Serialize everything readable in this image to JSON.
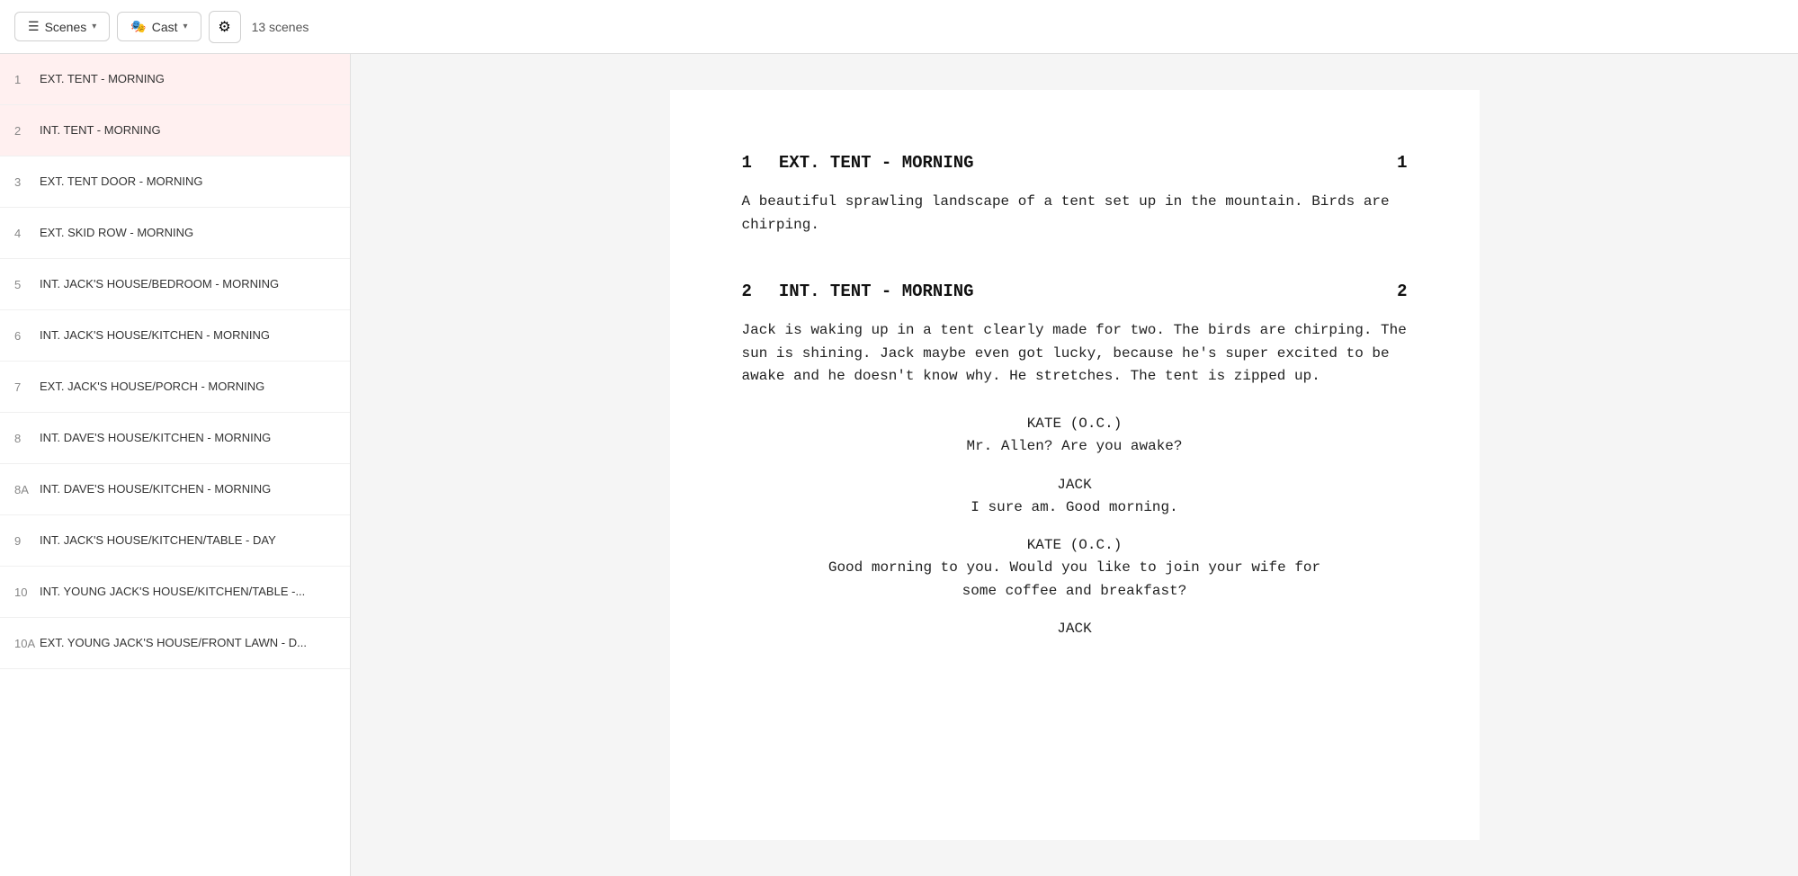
{
  "toolbar": {
    "scenes_label": "Scenes",
    "cast_label": "Cast",
    "scene_count": "13 scenes",
    "scenes_icon": "☰",
    "cast_icon": "🎭",
    "gear_icon": "⚙"
  },
  "sidebar": {
    "items": [
      {
        "number": "1",
        "label": "EXT. TENT - MORNING",
        "highlight": true
      },
      {
        "number": "2",
        "label": "INT. TENT - MORNING",
        "highlight": true
      },
      {
        "number": "3",
        "label": "EXT. TENT DOOR - MORNING",
        "highlight": false
      },
      {
        "number": "4",
        "label": "EXT. SKID ROW - MORNING",
        "highlight": false
      },
      {
        "number": "5",
        "label": "INT. JACK'S HOUSE/BEDROOM - MORNING",
        "highlight": false
      },
      {
        "number": "6",
        "label": "INT. JACK'S HOUSE/KITCHEN - MORNING",
        "highlight": false
      },
      {
        "number": "7",
        "label": "EXT. JACK'S HOUSE/PORCH - MORNING",
        "highlight": false
      },
      {
        "number": "8",
        "label": "INT. DAVE'S HOUSE/KITCHEN - MORNING",
        "highlight": false
      },
      {
        "number": "8A",
        "label": "INT. DAVE'S HOUSE/KITCHEN - MORNING",
        "highlight": false
      },
      {
        "number": "9",
        "label": "INT. JACK'S HOUSE/KITCHEN/TABLE - DAY",
        "highlight": false
      },
      {
        "number": "10",
        "label": "INT. YOUNG JACK'S HOUSE/KITCHEN/TABLE -...",
        "highlight": false
      },
      {
        "number": "10A",
        "label": "EXT. YOUNG JACK'S HOUSE/FRONT LAWN - D...",
        "highlight": false
      }
    ]
  },
  "script": {
    "scenes": [
      {
        "number": "1",
        "title": "EXT. TENT - MORNING",
        "number_right": "1",
        "action": "A beautiful sprawling landscape of a tent set up in the\nmountain. Birds are chirping."
      },
      {
        "number": "2",
        "title": "INT. TENT - MORNING",
        "number_right": "2",
        "action": "Jack is waking up in a tent clearly made for two. The birds\nare chirping. The sun is shining. Jack maybe even got lucky,\nbecause he's super excited to be awake and he doesn't know\nwhy. He stretches. The tent is zipped up.",
        "dialogue": [
          {
            "character": "KATE (O.C.)",
            "lines": "Mr. Allen? Are you awake?"
          },
          {
            "character": "JACK",
            "lines": "I sure am. Good morning."
          },
          {
            "character": "KATE (O.C.)",
            "lines": "Good morning to you. Would you like\nto join your wife for some coffee\nand breakfast?"
          },
          {
            "character": "JACK",
            "lines": ""
          }
        ]
      }
    ]
  }
}
